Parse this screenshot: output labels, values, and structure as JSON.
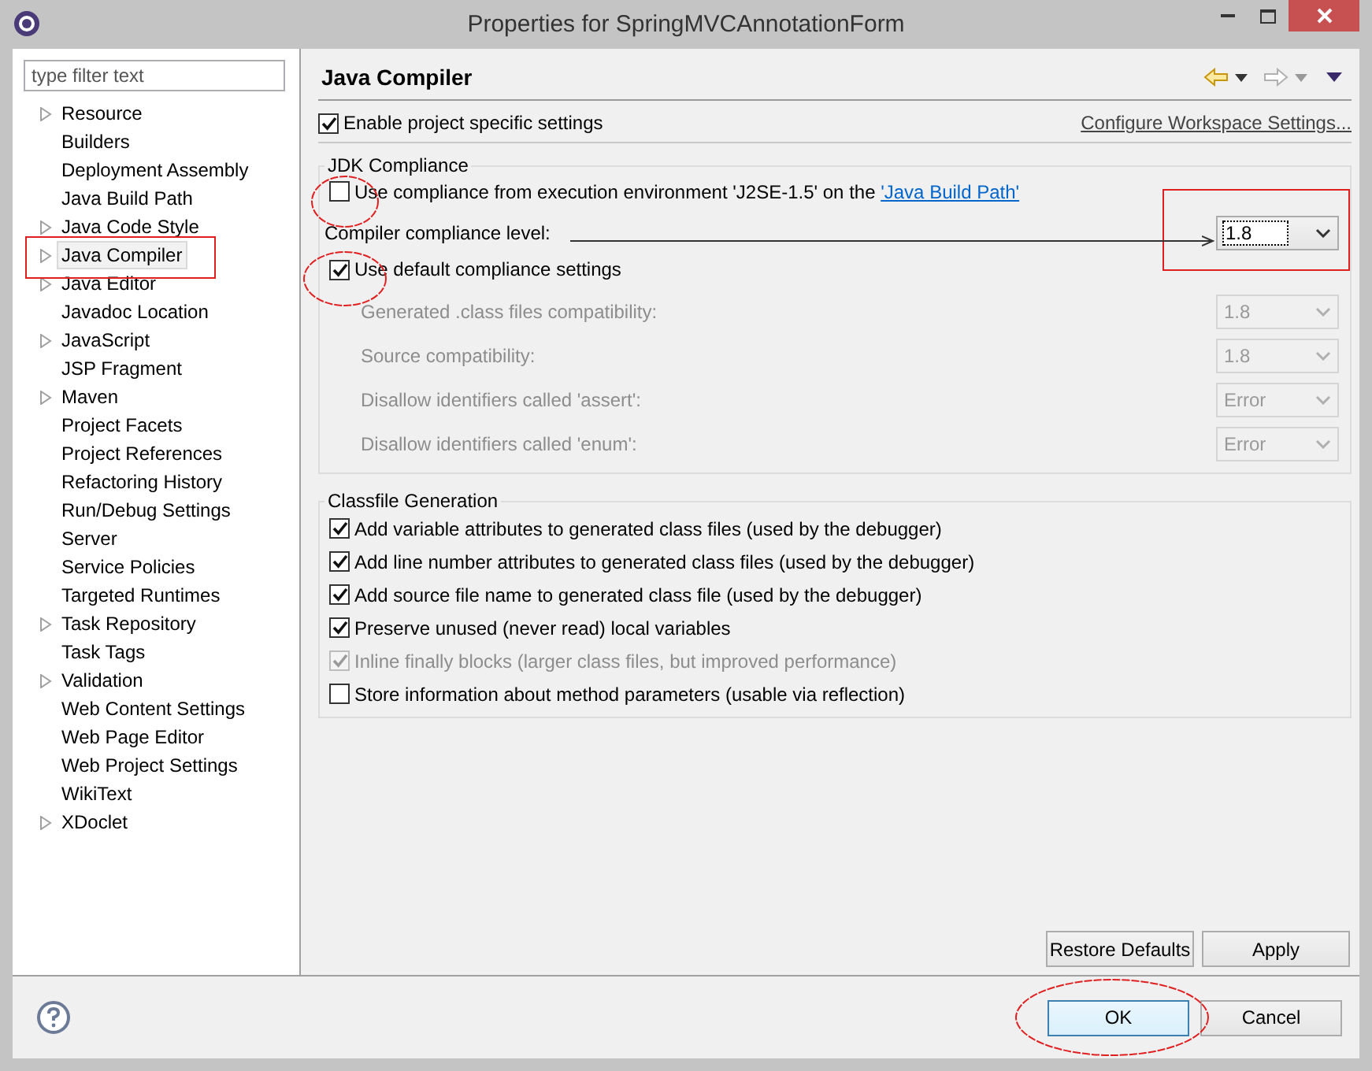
{
  "window": {
    "title": "Properties for SpringMVCAnnotationForm"
  },
  "filter": {
    "placeholder": "type filter text"
  },
  "tree": [
    {
      "label": "Resource",
      "expandable": true,
      "selected": false
    },
    {
      "label": "Builders",
      "expandable": false,
      "selected": false
    },
    {
      "label": "Deployment Assembly",
      "expandable": false,
      "selected": false
    },
    {
      "label": "Java Build Path",
      "expandable": false,
      "selected": false
    },
    {
      "label": "Java Code Style",
      "expandable": true,
      "selected": false
    },
    {
      "label": "Java Compiler",
      "expandable": true,
      "selected": true
    },
    {
      "label": "Java Editor",
      "expandable": true,
      "selected": false
    },
    {
      "label": "Javadoc Location",
      "expandable": false,
      "selected": false
    },
    {
      "label": "JavaScript",
      "expandable": true,
      "selected": false
    },
    {
      "label": "JSP Fragment",
      "expandable": false,
      "selected": false
    },
    {
      "label": "Maven",
      "expandable": true,
      "selected": false
    },
    {
      "label": "Project Facets",
      "expandable": false,
      "selected": false
    },
    {
      "label": "Project References",
      "expandable": false,
      "selected": false
    },
    {
      "label": "Refactoring History",
      "expandable": false,
      "selected": false
    },
    {
      "label": "Run/Debug Settings",
      "expandable": false,
      "selected": false
    },
    {
      "label": "Server",
      "expandable": false,
      "selected": false
    },
    {
      "label": "Service Policies",
      "expandable": false,
      "selected": false
    },
    {
      "label": "Targeted Runtimes",
      "expandable": false,
      "selected": false
    },
    {
      "label": "Task Repository",
      "expandable": true,
      "selected": false
    },
    {
      "label": "Task Tags",
      "expandable": false,
      "selected": false
    },
    {
      "label": "Validation",
      "expandable": true,
      "selected": false
    },
    {
      "label": "Web Content Settings",
      "expandable": false,
      "selected": false
    },
    {
      "label": "Web Page Editor",
      "expandable": false,
      "selected": false
    },
    {
      "label": "Web Project Settings",
      "expandable": false,
      "selected": false
    },
    {
      "label": "WikiText",
      "expandable": false,
      "selected": false
    },
    {
      "label": "XDoclet",
      "expandable": true,
      "selected": false
    }
  ],
  "page": {
    "title": "Java Compiler",
    "enable": {
      "label": "Enable project specific settings",
      "checked": true
    },
    "configure_link": "Configure Workspace Settings...",
    "jdk": {
      "title": "JDK Compliance",
      "use_ee": {
        "text": "Use compliance from execution environment 'J2SE-1.5' on the ",
        "link": "'Java Build Path'",
        "checked": false
      },
      "level": {
        "label": "Compiler compliance level:",
        "value": "1.8"
      },
      "use_default": {
        "label": "Use default compliance settings",
        "checked": true
      },
      "settings": [
        {
          "label": "Generated .class files compatibility:",
          "value": "1.8",
          "disabled": true
        },
        {
          "label": "Source compatibility:",
          "value": "1.8",
          "disabled": true
        },
        {
          "label": "Disallow identifiers called 'assert':",
          "value": "Error",
          "disabled": true
        },
        {
          "label": "Disallow identifiers called 'enum':",
          "value": "Error",
          "disabled": true
        }
      ]
    },
    "classfile": {
      "title": "Classfile Generation",
      "options": [
        {
          "label": "Add variable attributes to generated class files (used by the debugger)",
          "checked": true,
          "disabled": false
        },
        {
          "label": "Add line number attributes to generated class files (used by the debugger)",
          "checked": true,
          "disabled": false
        },
        {
          "label": "Add source file name to generated class file (used by the debugger)",
          "checked": true,
          "disabled": false
        },
        {
          "label": "Preserve unused (never read) local variables",
          "checked": true,
          "disabled": false
        },
        {
          "label": "Inline finally blocks (larger class files, but improved performance)",
          "checked": true,
          "disabled": true
        },
        {
          "label": "Store information about method parameters (usable via reflection)",
          "checked": false,
          "disabled": false
        }
      ]
    },
    "restore": "Restore Defaults",
    "apply": "Apply"
  },
  "buttons": [
    {
      "label": "OK",
      "default": true
    },
    {
      "label": "Cancel",
      "default": false
    }
  ]
}
